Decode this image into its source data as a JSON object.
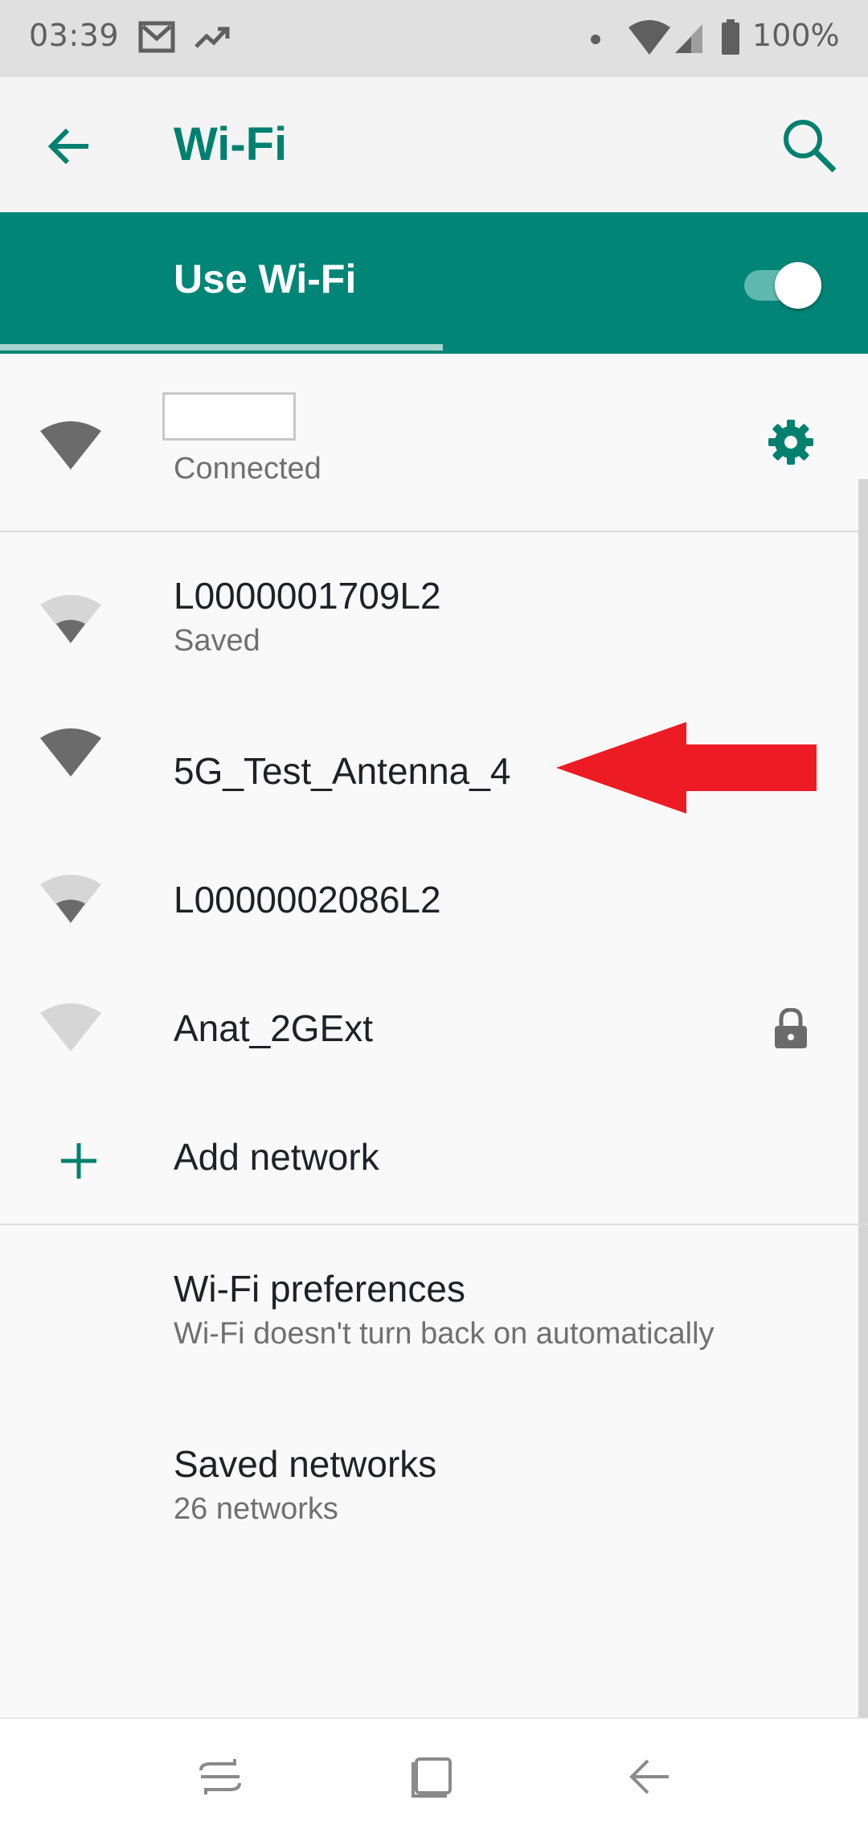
{
  "status_bar": {
    "time": "03:39",
    "battery": "100%",
    "icons": [
      "gmail-icon",
      "trending-icon",
      "dot-icon",
      "wifi-signal-icon",
      "cell-signal-icon",
      "battery-icon"
    ]
  },
  "app_bar": {
    "title": "Wi-Fi",
    "back_icon": "arrow-back-icon",
    "search_icon": "search-icon"
  },
  "wifi_toggle": {
    "label": "Use Wi-Fi",
    "enabled": true,
    "scan_progress": 0.51
  },
  "connected_network": {
    "ssid": "",
    "status": "Connected",
    "signal": "strong",
    "settings_icon": "gear-icon"
  },
  "networks": [
    {
      "ssid": "L0000001709L2",
      "status": "Saved",
      "signal": "weak",
      "secured": false
    },
    {
      "ssid": "5G_Test_Antenna_4",
      "status": "",
      "signal": "strong",
      "secured": false
    },
    {
      "ssid": "L0000002086L2",
      "status": "",
      "signal": "weak",
      "secured": false
    },
    {
      "ssid": "Anat_2GExt",
      "status": "",
      "signal": "none",
      "secured": true
    }
  ],
  "add_network": {
    "label": "Add network",
    "icon": "plus-icon"
  },
  "preferences": {
    "title": "Wi-Fi preferences",
    "subtitle": "Wi-Fi doesn't turn back on automatically"
  },
  "saved_networks": {
    "title": "Saved networks",
    "subtitle": "26 networks"
  },
  "annotation": {
    "icon": "red-arrow-icon",
    "color": "#ed1c24"
  },
  "colors": {
    "accent": "#00806f",
    "header": "#008577",
    "status_bar": "#e0e0e0"
  },
  "nav_bar": {
    "icons": [
      "recents-icon",
      "home-icon",
      "back-icon"
    ]
  }
}
